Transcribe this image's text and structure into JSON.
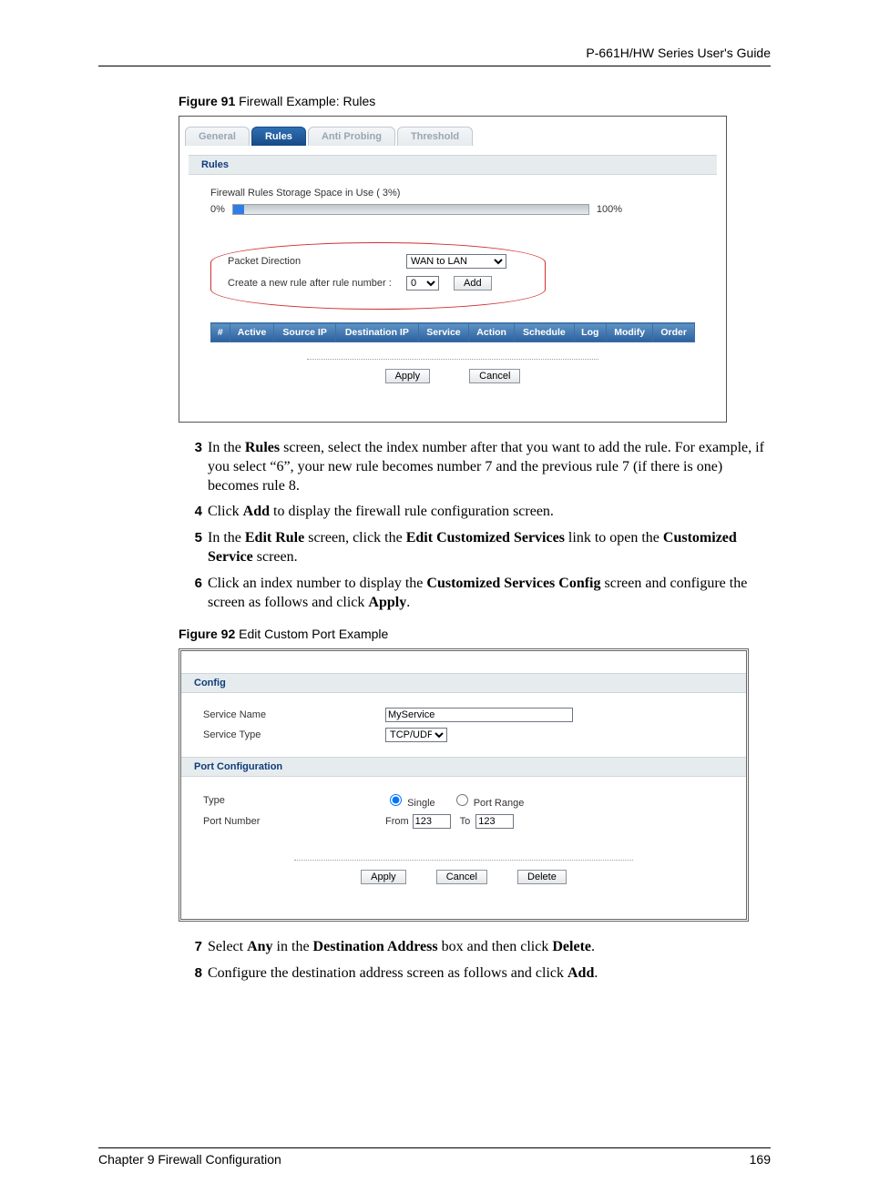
{
  "header_right": "P-661H/HW Series User's Guide",
  "figure91": {
    "caption_bold": "Figure 91",
    "caption_rest": "   Firewall Example: Rules",
    "tabs": [
      "General",
      "Rules",
      "Anti Probing",
      "Threshold"
    ],
    "active_tab": 1,
    "rules_title": "Rules",
    "storage_label": "Firewall Rules Storage Space in Use  ( 3%)",
    "pct_left": "0%",
    "pct_right": "100%",
    "packet_dir_label": "Packet Direction",
    "packet_dir_value": "WAN to LAN",
    "create_rule_label": "Create a new rule after rule number :",
    "create_rule_value": "0",
    "add_btn": "Add",
    "cols": [
      "#",
      "Active",
      "Source IP",
      "Destination IP",
      "Service",
      "Action",
      "Schedule",
      "Log",
      "Modify",
      "Order"
    ],
    "apply": "Apply",
    "cancel": "Cancel"
  },
  "steps_a": [
    {
      "n": "3",
      "html": "In the <b>Rules</b> screen, select the index number after that you want to add the rule. For example, if you select “6”, your new rule becomes number 7 and the previous rule 7 (if there is one) becomes rule 8."
    },
    {
      "n": "4",
      "html": "Click <b>Add</b> to display the firewall rule configuration screen."
    },
    {
      "n": "5",
      "html": "In the <b>Edit Rule</b> screen, click the <b>Edit Customized Services</b> link to open the <b>Customized Service</b> screen."
    },
    {
      "n": "6",
      "html": "Click an index number to display the <b>Customized Services Config</b> screen and configure the screen as follows and click <b>Apply</b>."
    }
  ],
  "figure92": {
    "caption_bold": "Figure 92",
    "caption_rest": "   Edit Custom Port Example",
    "config_title": "Config",
    "service_name_label": "Service Name",
    "service_name_value": "MyService",
    "service_type_label": "Service Type",
    "service_type_value": "TCP/UDP",
    "port_config_title": "Port Configuration",
    "type_label": "Type",
    "single_label": "Single",
    "range_label": "Port Range",
    "port_number_label": "Port Number",
    "from_label": "From",
    "from_value": "123",
    "to_label": "To",
    "to_value": "123",
    "apply": "Apply",
    "cancel": "Cancel",
    "delete": "Delete"
  },
  "steps_b": [
    {
      "n": "7",
      "html": "Select <b>Any</b> in the <b>Destination Address</b> box and then click <b>Delete</b>."
    },
    {
      "n": "8",
      "html": "Configure the destination address screen as follows and click <b>Add</b>."
    }
  ],
  "footer_left": "Chapter 9 Firewall Configuration",
  "footer_right": "169"
}
